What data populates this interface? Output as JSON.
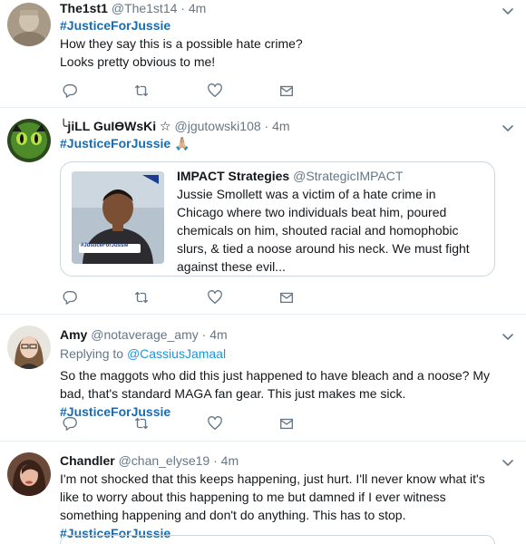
{
  "tweets": [
    {
      "name": "The1st1",
      "handle": "@The1st14",
      "dot": "·",
      "time": "4m",
      "hashtag": "#JusticeForJussie",
      "line1": "How they say this is a possible hate crime?",
      "line2": "Looks pretty obvious to me!"
    },
    {
      "name": "╰jiLL GuIƟWsKi ☆",
      "handle": "@jgutowski108",
      "dot": "·",
      "time": "4m",
      "hashtag": "#JusticeForJussie",
      "emoji": "🙏🏼",
      "quote": {
        "name": "IMPACT Strategies",
        "handle": "@StrategicIMPACT",
        "text": "Jussie Smollett was a victim of a hate crime in Chicago where two individuals beat him, poured chemicals on him, shouted racial and homophobic slurs, & tied a noose around his neck. We must fight against these evil...",
        "image_tag": "#JusticeForJussie"
      }
    },
    {
      "name": "Amy",
      "handle": "@notaverage_amy",
      "dot": "·",
      "time": "4m",
      "replying_prefix": "Replying to",
      "replying_to": "@CassiusJamaal",
      "text": "So the maggots who did this just happened to have bleach and a noose? My bad, that's standard MAGA fan gear. This just makes me sick.",
      "hashtag": "#JusticeForJussie"
    },
    {
      "name": "Chandler",
      "handle": "@chan_elyse19",
      "dot": "·",
      "time": "4m",
      "text": "I'm not shocked that this keeps happening, just hurt. I'll never know what it's like to worry about this happening to me but damned if I ever witness something happening and don't do anything. This has to stop.",
      "hashtag": "#JusticeForJussie"
    }
  ],
  "icons": {
    "reply": "reply-icon",
    "retweet": "retweet-icon",
    "like": "heart-icon",
    "dm": "mail-icon",
    "caret": "chevron-down-icon"
  },
  "colors": {
    "hashtag": "#1b6bb0",
    "link": "#1b95e0",
    "meta": "#657786",
    "icon": "#657786"
  }
}
